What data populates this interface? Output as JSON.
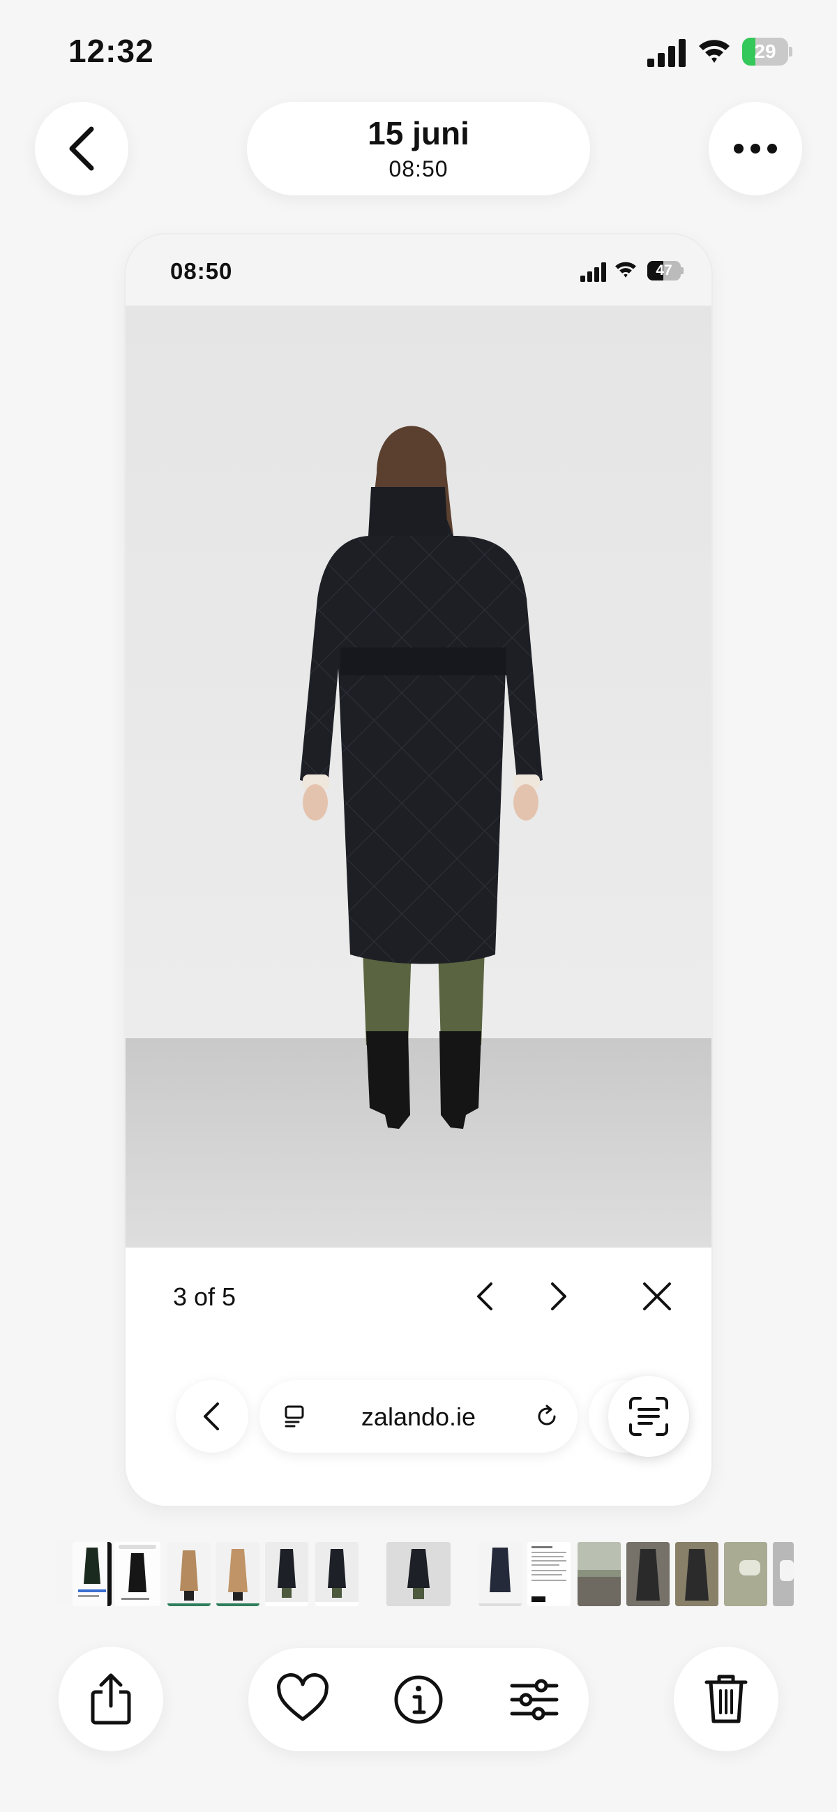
{
  "status_bar": {
    "time": "12:32",
    "battery_level": "29",
    "charging": true
  },
  "header": {
    "date": "15 juni",
    "time": "08:50"
  },
  "screenshot": {
    "status_bar": {
      "time": "08:50",
      "battery_level": "47"
    },
    "product_image": "Woman seen from behind wearing a long black quilted belted coat, olive trousers and black boots, grey studio background",
    "pager": {
      "count_label": "3 of 5"
    },
    "browser": {
      "url": "zalando.ie"
    }
  },
  "thumbnails": [
    {
      "kind": "screenshot-white"
    },
    {
      "kind": "coat-black-search"
    },
    {
      "kind": "coat-black-search"
    },
    {
      "kind": "coat-camel"
    },
    {
      "kind": "coat-camel"
    },
    {
      "kind": "coat-black"
    },
    {
      "kind": "coat-black"
    },
    {
      "kind": "coat-black-selected"
    },
    {
      "kind": "coat-navy"
    },
    {
      "kind": "document"
    },
    {
      "kind": "photo-outdoor"
    },
    {
      "kind": "coat-grey"
    },
    {
      "kind": "coat-grey"
    },
    {
      "kind": "blurred"
    },
    {
      "kind": "blurred"
    }
  ],
  "colors": {
    "accent_battery": "#34c759",
    "background": "#f6f6f6"
  },
  "toolbar": {
    "share_icon": "share-icon",
    "favorite_icon": "heart-icon",
    "info_icon": "info-icon",
    "adjust_icon": "sliders-icon",
    "delete_icon": "trash-icon"
  }
}
